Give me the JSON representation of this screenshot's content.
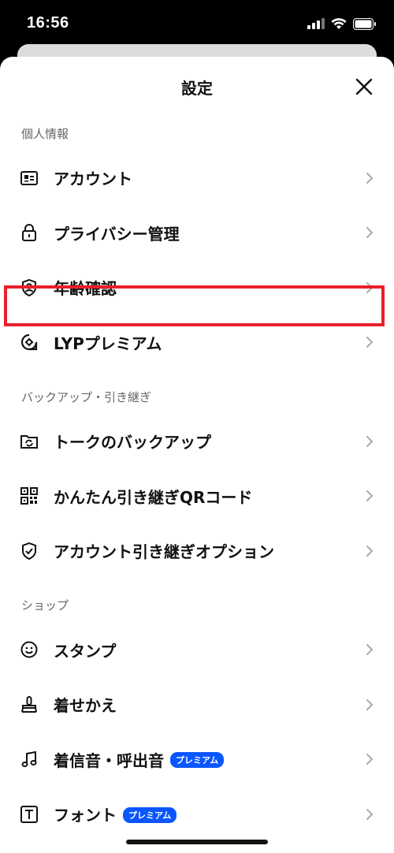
{
  "status": {
    "time": "16:56"
  },
  "header": {
    "title": "設定"
  },
  "sections": [
    {
      "title": "個人情報",
      "items": [
        {
          "label": "アカウント",
          "icon": "id-card-icon"
        },
        {
          "label": "プライバシー管理",
          "icon": "lock-icon"
        },
        {
          "label": "年齢確認",
          "icon": "shield-user-icon"
        },
        {
          "label": "LYPプレミアム",
          "icon": "lyp-premium-icon"
        }
      ]
    },
    {
      "title": "バックアップ・引き継ぎ",
      "items": [
        {
          "label": "トークのバックアップ",
          "icon": "folder-sync-icon"
        },
        {
          "label": "かんたん引き継ぎQRコード",
          "icon": "qr-code-icon"
        },
        {
          "label": "アカウント引き継ぎオプション",
          "icon": "shield-check-icon"
        }
      ]
    },
    {
      "title": "ショップ",
      "items": [
        {
          "label": "スタンプ",
          "icon": "smiley-icon"
        },
        {
          "label": "着せかえ",
          "icon": "brush-icon"
        },
        {
          "label": "着信音・呼出音",
          "icon": "music-note-icon",
          "badge": "プレミアム"
        },
        {
          "label": "フォント",
          "icon": "font-icon",
          "badge": "プレミアム"
        }
      ]
    }
  ],
  "colors": {
    "highlight": "#e8202a",
    "badge": "#0a56ff"
  }
}
